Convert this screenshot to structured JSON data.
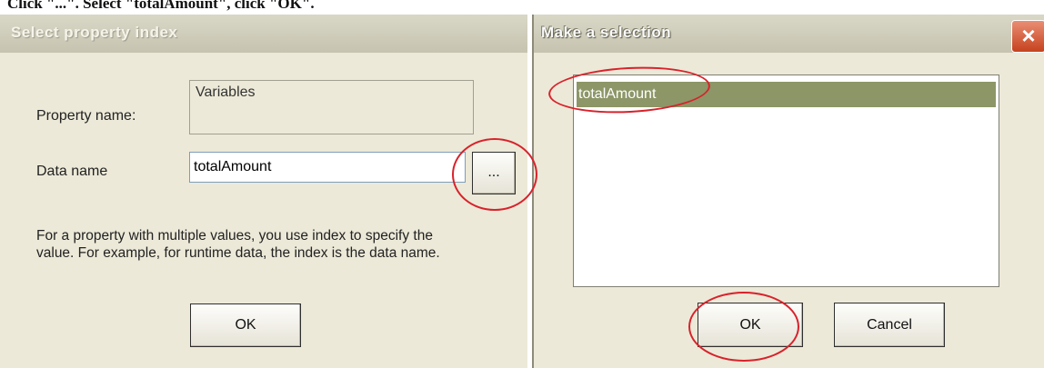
{
  "caption": "Click \"...\". Select \"totalAmount\", click \"OK\".",
  "dialog_property": {
    "title": "Select property index",
    "property_label": "Property name:",
    "property_value": "Variables",
    "data_label": "Data name",
    "data_value": "totalAmount",
    "browse_label": "...",
    "help_text": "For a property with multiple values, you use index to specify the value. For example, for runtime data, the index is the data name.",
    "ok_label": "OK"
  },
  "dialog_selection": {
    "title": "Make a selection",
    "close_icon": "×",
    "items": [
      "totalAmount"
    ],
    "ok_label": "OK",
    "cancel_label": "Cancel"
  },
  "colors": {
    "highlight": "#d8222b",
    "selected_item": "#8c9667",
    "dialog_bg": "#ece9d8"
  }
}
